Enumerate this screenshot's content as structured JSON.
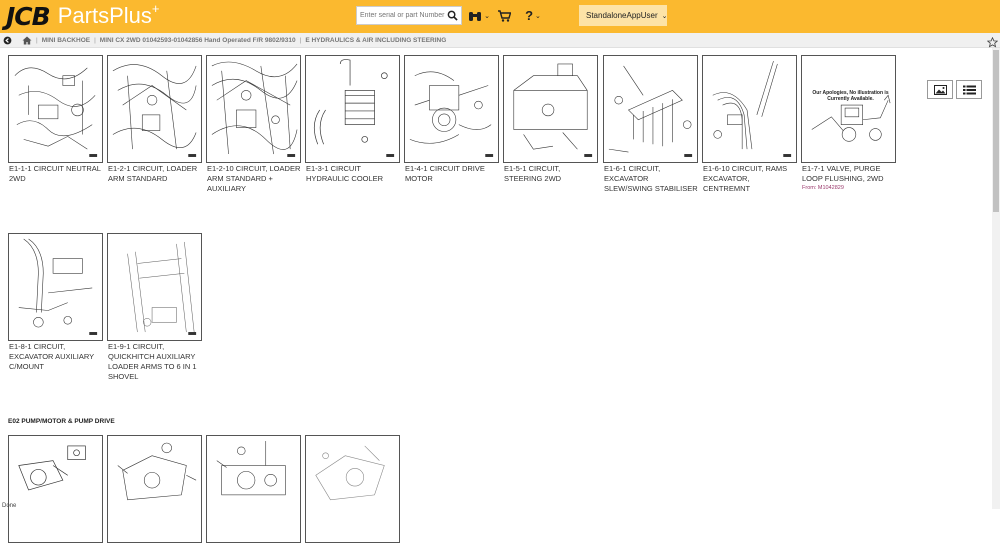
{
  "header": {
    "brand": "JCB",
    "product": "PartsPlus",
    "plus_mark": "+",
    "search_placeholder": "Enter serial or part Number",
    "help_label": "?",
    "user_label": "StandaloneAppUser",
    "accent": "#fbb92f"
  },
  "breadcrumb": {
    "items": [
      "MINI BACKHOE",
      "MINI CX 2WD 01042593-01042856 Hand Operated F/R 9802/9310",
      "E HYDRAULICS & AIR INCLUDING STEERING"
    ]
  },
  "cards": [
    {
      "caption": "E1-1-1 CIRCUIT NEUTRAL 2WD"
    },
    {
      "caption": "E1-2-1 CIRCUIT, LOADER ARM STANDARD"
    },
    {
      "caption": "E1-2-10 CIRCUIT, LOADER ARM STANDARD + AUXILIARY"
    },
    {
      "caption": "E1-3-1 CIRCUIT HYDRAULIC COOLER"
    },
    {
      "caption": "E1-4-1 CIRCUIT DRIVE MOTOR"
    },
    {
      "caption": "E1-5-1 CIRCUIT, STEERING 2WD"
    },
    {
      "caption": "E1-6-1 CIRCUIT, EXCAVATOR SLEW/SWING STABILISER"
    },
    {
      "caption": "E1-6-10 CIRCUIT, RAMS EXCAVATOR, CENTREMNT"
    },
    {
      "caption": "E1-7-1 VALVE, PURGE LOOP FLUSHING, 2WD",
      "from": "From: M1042829",
      "apology": "Our Apologies, No illustration is Currently Available."
    },
    {
      "caption": "E1-8-1 CIRCUIT, EXCAVATOR AUXILIARY C/MOUNT"
    },
    {
      "caption": "E1-9-1 CIRCUIT, QUICKHITCH AUXILIARY LOADER ARMS TO 6 IN 1 SHOVEL"
    }
  ],
  "section2": {
    "title": "E02 PUMP/MOTOR & PUMP DRIVE"
  },
  "status": "Done"
}
